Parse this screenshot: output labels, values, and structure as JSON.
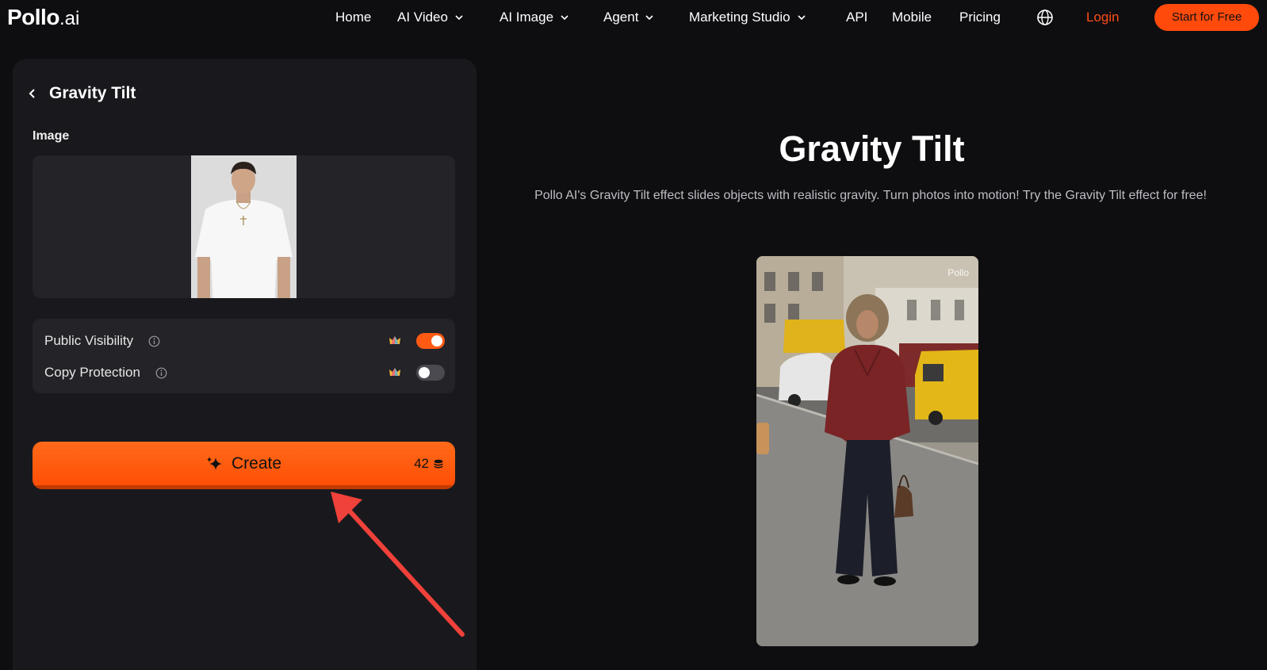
{
  "brand": {
    "name_main": "Pollo",
    "name_suffix": ".ai"
  },
  "nav": {
    "items": [
      {
        "label": "Home",
        "has_dropdown": false
      },
      {
        "label": "AI Video",
        "has_dropdown": true
      },
      {
        "label": "AI Image",
        "has_dropdown": true
      },
      {
        "label": "Agent",
        "has_dropdown": true
      },
      {
        "label": "Marketing Studio",
        "has_dropdown": true
      },
      {
        "label": "API",
        "has_dropdown": false
      },
      {
        "label": "Mobile",
        "has_dropdown": false
      },
      {
        "label": "Pricing",
        "has_dropdown": false
      }
    ],
    "language_icon": "globe-icon",
    "login_label": "Login",
    "cta_label": "Start for Free"
  },
  "panel": {
    "title": "Gravity Tilt",
    "image_label": "Image",
    "toggles": [
      {
        "label": "Public Visibility",
        "on": true
      },
      {
        "label": "Copy Protection",
        "on": false
      }
    ],
    "create_label": "Create",
    "credits": "42"
  },
  "main": {
    "title": "Gravity Tilt",
    "description": "Pollo AI's Gravity Tilt effect slides objects with realistic gravity. Turn photos into motion! Try the Gravity Tilt effect for free!",
    "watermark": "Pollo"
  },
  "colors": {
    "accent": "#ff4a0c",
    "login": "#ff4d14",
    "background": "#0e0e11",
    "panel": "#19191d",
    "card": "#232328"
  }
}
